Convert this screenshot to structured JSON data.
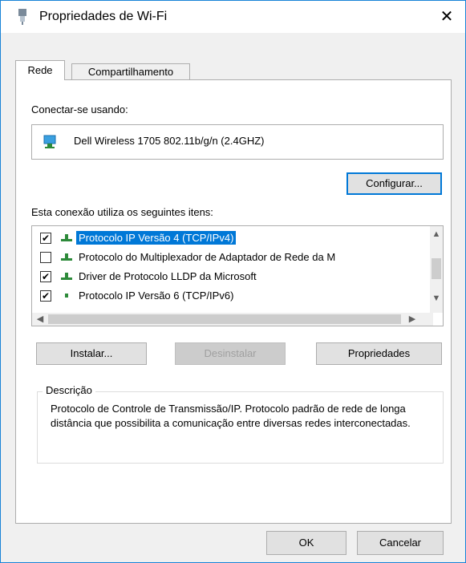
{
  "window": {
    "title": "Propriedades de Wi-Fi",
    "close_glyph": "✕"
  },
  "tabs": [
    {
      "label": "Rede"
    },
    {
      "label": "Compartilhamento"
    }
  ],
  "connect_label": "Conectar-se usando:",
  "adapter_name": "Dell Wireless 1705 802.11b/g/n (2.4GHZ)",
  "configure_button": "Configurar...",
  "items_label": "Esta conexão utiliza os seguintes itens:",
  "items": [
    {
      "label": "Protocolo IP Versão 4 (TCP/IPv4)",
      "checked": true,
      "selected": true
    },
    {
      "label": "Protocolo do Multiplexador de Adaptador de Rede da M",
      "checked": false,
      "selected": false
    },
    {
      "label": "Driver de Protocolo LLDP da Microsoft",
      "checked": true,
      "selected": false
    },
    {
      "label": "Protocolo IP Versão 6 (TCP/IPv6)",
      "checked": true,
      "selected": false
    }
  ],
  "buttons": {
    "install": "Instalar...",
    "uninstall": "Desinstalar",
    "properties": "Propriedades"
  },
  "description": {
    "legend": "Descrição",
    "text": "Protocolo de Controle de Transmissão/IP. Protocolo padrão de rede de longa distância que possibilita a comunicação entre diversas redes interconectadas."
  },
  "footer": {
    "ok": "OK",
    "cancel": "Cancelar"
  },
  "colors": {
    "accent": "#0078d7",
    "selection": "#0078d7",
    "window_border": "#1883d7"
  }
}
